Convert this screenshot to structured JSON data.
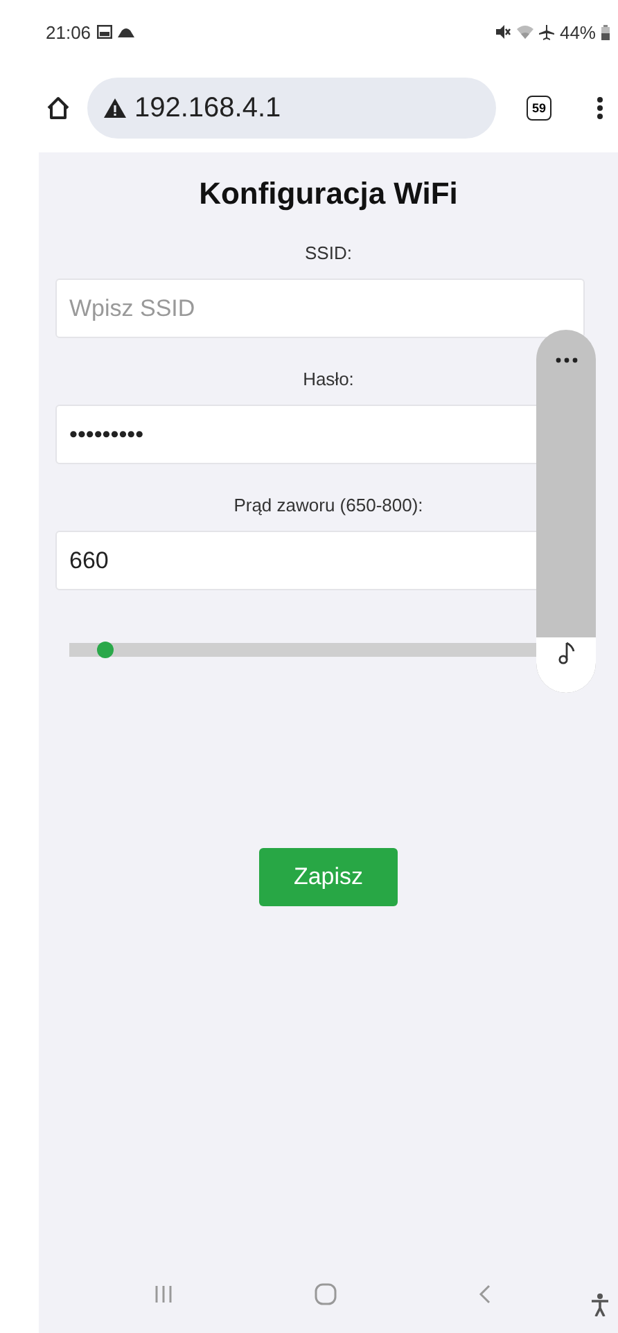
{
  "status_bar": {
    "time": "21:06",
    "battery": "44%"
  },
  "browser": {
    "url": "192.168.4.1",
    "tab_count": "59"
  },
  "page": {
    "title": "Konfiguracja WiFi",
    "fields": [
      {
        "label": "SSID:",
        "placeholder": "Wpisz SSID"
      },
      {
        "label": "Hasło:",
        "value": "•••••••••"
      },
      {
        "label": "Prąd zaworu (650-800):",
        "value": "660"
      }
    ],
    "slider": {
      "level": 0.07
    },
    "button": "Zapisz"
  }
}
